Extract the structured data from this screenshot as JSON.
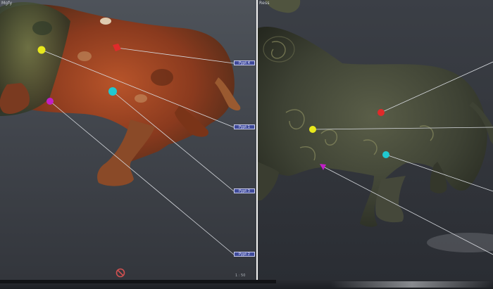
{
  "left_view": {
    "title": "Mgfy",
    "tags": [
      "Pypt 4",
      "Pypt 1",
      "Pypt 3",
      "Pypt 2"
    ],
    "corner_label": "1 : 50",
    "nav_icon": "no-entry-icon"
  },
  "right_view": {
    "title": "Ress"
  },
  "marker_colors": {
    "red": "#e02a2a",
    "yellow": "#e8e81c",
    "cyan": "#20c8d0",
    "magenta": "#c21fc7"
  },
  "tag_color": "#3f4a9a"
}
